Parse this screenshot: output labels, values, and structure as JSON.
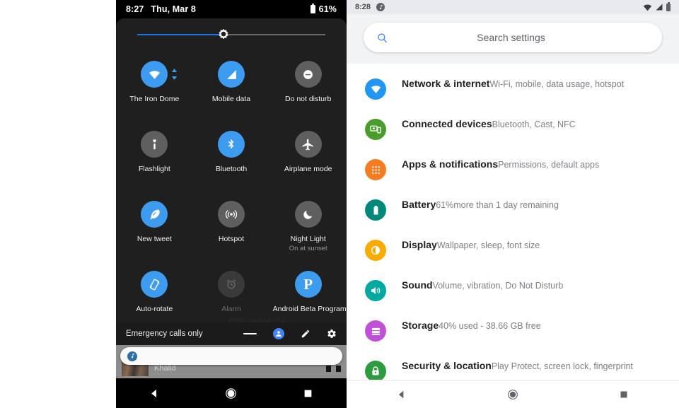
{
  "quick_settings": {
    "status_bar": {
      "time": "8:27",
      "date": "Thu, Mar 8",
      "battery_percent": "61%"
    },
    "brightness": {
      "value_percent": 46
    },
    "tiles": [
      {
        "label": "The Iron Dome",
        "sub": "",
        "state": "on",
        "icon": "wifi-icon",
        "has_caret": true
      },
      {
        "label": "Mobile data",
        "sub": "",
        "state": "on",
        "icon": "mobile-data-icon",
        "has_caret": false
      },
      {
        "label": "Do not disturb",
        "sub": "",
        "state": "off",
        "icon": "do-not-disturb-icon",
        "has_caret": false
      },
      {
        "label": "Flashlight",
        "sub": "",
        "state": "off",
        "icon": "flashlight-icon",
        "has_caret": false
      },
      {
        "label": "Bluetooth",
        "sub": "",
        "state": "on",
        "icon": "bluetooth-icon",
        "has_caret": false
      },
      {
        "label": "Airplane mode",
        "sub": "",
        "state": "off",
        "icon": "airplane-icon",
        "has_caret": false
      },
      {
        "label": "New tweet",
        "sub": "",
        "state": "on",
        "icon": "feather-icon",
        "has_caret": false
      },
      {
        "label": "Hotspot",
        "sub": "",
        "state": "off",
        "icon": "hotspot-icon",
        "has_caret": false
      },
      {
        "label": "Night Light",
        "sub": "On at sunset",
        "state": "off",
        "icon": "moon-icon",
        "has_caret": false
      },
      {
        "label": "Auto-rotate",
        "sub": "",
        "state": "on",
        "icon": "rotate-icon",
        "has_caret": false
      },
      {
        "label": "Alarm",
        "sub": "",
        "state": "dim",
        "icon": "alarm-icon",
        "has_caret": false
      },
      {
        "label": "Android Beta Program",
        "sub": "",
        "state": "on",
        "icon": "beta-p-icon",
        "has_caret": false
      }
    ],
    "build_number": "PPP1.180208.014",
    "footer": {
      "carrier_text": "Emergency calls only",
      "collapse_label": "Collapse",
      "user_label": "User",
      "edit_label": "Edit",
      "settings_label": "Settings"
    },
    "notification": {
      "media_title": "Khalid",
      "card_icon": "music-note-icon"
    },
    "navigation": {
      "back": "Back",
      "home": "Home",
      "recents": "Recents"
    }
  },
  "settings": {
    "status_bar": {
      "time": "8:28"
    },
    "search": {
      "placeholder": "Search settings",
      "value": ""
    },
    "items": [
      {
        "title": "Network & internet",
        "subtitle": "Wi-Fi, mobile, data usage, hotspot",
        "color": "#2196f3",
        "icon": "network-icon"
      },
      {
        "title": "Connected devices",
        "subtitle": "Bluetooth, Cast, NFC",
        "color": "#4a9c2d",
        "icon": "connected-devices-icon"
      },
      {
        "title": "Apps & notifications",
        "subtitle": "Permissions, default apps",
        "color": "#f57c20",
        "icon": "apps-grid-icon"
      },
      {
        "title": "Battery",
        "subtitle": "61%more than 1 day remaining",
        "color": "#00897b",
        "icon": "battery-icon"
      },
      {
        "title": "Display",
        "subtitle": "Wallpaper, sleep, font size",
        "color": "#f9ab00",
        "icon": "brightness-icon"
      },
      {
        "title": "Sound",
        "subtitle": "Volume, vibration, Do Not Disturb",
        "color": "#00aaa0",
        "icon": "speaker-icon"
      },
      {
        "title": "Storage",
        "subtitle": "40% used - 38.66 GB free",
        "color": "#c050d8",
        "icon": "storage-icon"
      },
      {
        "title": "Security & location",
        "subtitle": "Play Protect, screen lock, fingerprint",
        "color": "#2e9b3f",
        "icon": "lock-icon"
      }
    ],
    "navigation": {
      "back": "Back",
      "home": "Home",
      "recents": "Recents"
    }
  },
  "theme": {
    "accent_blue": "#3d9bf0",
    "slider_blue": "#1a73e8",
    "panel_dark": "#1f1f1f",
    "tile_off": "#5f5f5f"
  }
}
